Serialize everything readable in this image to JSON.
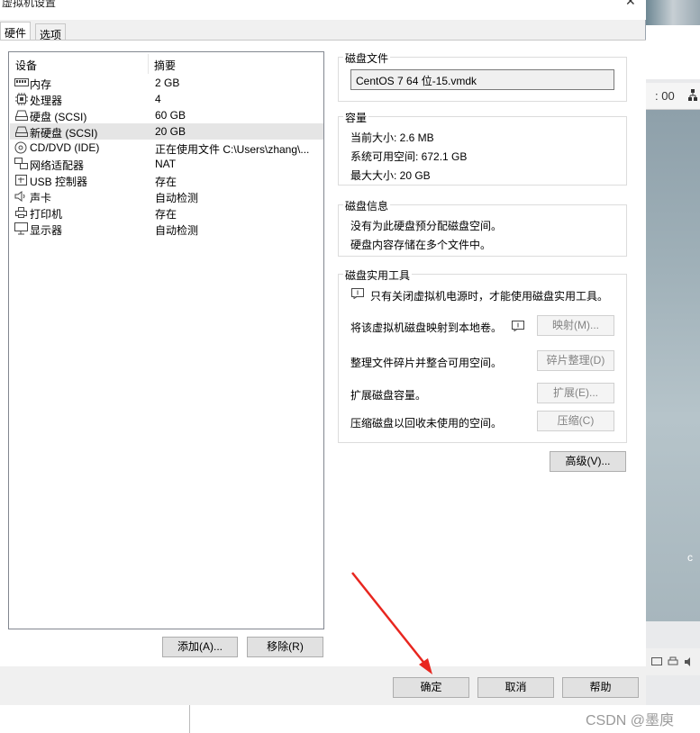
{
  "window": {
    "title": "虚拟机设置",
    "close_glyph": "✕"
  },
  "tabs": [
    {
      "label": "硬件",
      "active": true
    },
    {
      "label": "选项",
      "active": false
    }
  ],
  "device_list": {
    "col_device": "设备",
    "col_summary": "摘要",
    "rows": [
      {
        "icon": "memory-icon",
        "name": "内存",
        "summary": "2 GB"
      },
      {
        "icon": "cpu-icon",
        "name": "处理器",
        "summary": "4"
      },
      {
        "icon": "harddisk-icon",
        "name": "硬盘 (SCSI)",
        "summary": "60 GB"
      },
      {
        "icon": "harddisk-icon",
        "name": "新硬盘 (SCSI)",
        "summary": "20 GB",
        "selected": true
      },
      {
        "icon": "cd-icon",
        "name": "CD/DVD (IDE)",
        "summary": "正在使用文件 C:\\Users\\zhang\\..."
      },
      {
        "icon": "network-icon",
        "name": "网络适配器",
        "summary": "NAT"
      },
      {
        "icon": "usb-icon",
        "name": "USB 控制器",
        "summary": "存在"
      },
      {
        "icon": "sound-icon",
        "name": "声卡",
        "summary": "自动检测"
      },
      {
        "icon": "printer-icon",
        "name": "打印机",
        "summary": "存在"
      },
      {
        "icon": "monitor-icon",
        "name": "显示器",
        "summary": "自动检测"
      }
    ]
  },
  "list_buttons": {
    "add": "添加(A)...",
    "remove": "移除(R)"
  },
  "disk_file": {
    "title": "磁盘文件",
    "value": "CentOS 7 64 位-15.vmdk"
  },
  "capacity": {
    "title": "容量",
    "current": "当前大小: 2.6 MB",
    "available": "系统可用空间: 672.1 GB",
    "max": "最大大小: 20 GB"
  },
  "disk_info": {
    "title": "磁盘信息",
    "line1": "没有为此硬盘预分配磁盘空间。",
    "line2": "硬盘内容存储在多个文件中。"
  },
  "disk_utilities": {
    "title": "磁盘实用工具",
    "note": "只有关闭虚拟机电源时，才能使用磁盘实用工具。",
    "map_text": "将该虚拟机磁盘映射到本地卷。",
    "map_button": "映射(M)...",
    "defrag_text": "整理文件碎片并整合可用空间。",
    "defrag_button": "碎片整理(D)",
    "expand_text": "扩展磁盘容量。",
    "expand_button": "扩展(E)...",
    "compact_text": "压缩磁盘以回收未使用的空间。",
    "compact_button": "压缩(C)"
  },
  "advanced_button": "高级(V)...",
  "footer": {
    "ok": "确定",
    "cancel": "取消",
    "help": "帮助"
  },
  "background": {
    "clock_text": ": 00",
    "edge_letter": "c"
  },
  "watermark": "CSDN @墨庾",
  "colors": {
    "annotation_arrow": "#e8261f",
    "selection": "#e5e5e5"
  }
}
